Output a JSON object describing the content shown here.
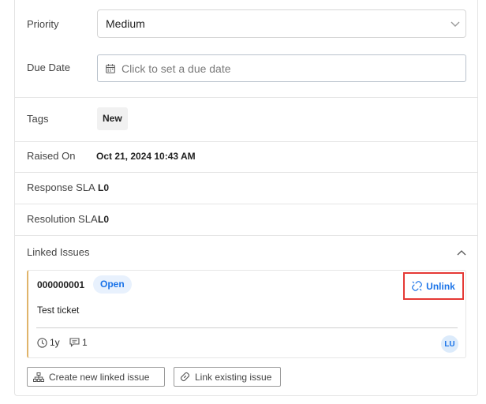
{
  "fields": {
    "priority_label": "Priority",
    "priority_value": "Medium",
    "due_date_label": "Due Date",
    "due_date_placeholder": "Click to set a due date",
    "tags_label": "Tags",
    "tag_value": "New",
    "raised_on_label": "Raised On",
    "raised_on_value": "Oct 21, 2024 10:43 AM",
    "response_sla_label": "Response SLA",
    "response_sla_value": "L0",
    "resolution_sla_label": "Resolution SLA",
    "resolution_sla_value": "L0"
  },
  "linked_issues": {
    "section_label": "Linked Issues",
    "items": [
      {
        "id": "000000001",
        "status": "Open",
        "title": "Test ticket",
        "age": "1y",
        "comments": "1",
        "assignee_initials": "LU",
        "unlink_label": "Unlink"
      }
    ],
    "create_button": "Create new linked issue",
    "link_button": "Link existing issue"
  },
  "colors": {
    "accent": "#1a73e8",
    "highlight_border": "#e53935",
    "card_left_border": "#e0b46a"
  },
  "icons": [
    "chevron-down-icon",
    "calendar-icon",
    "chevron-up-icon",
    "unlink-icon",
    "clock-icon",
    "comment-icon",
    "hierarchy-icon",
    "link-icon"
  ]
}
